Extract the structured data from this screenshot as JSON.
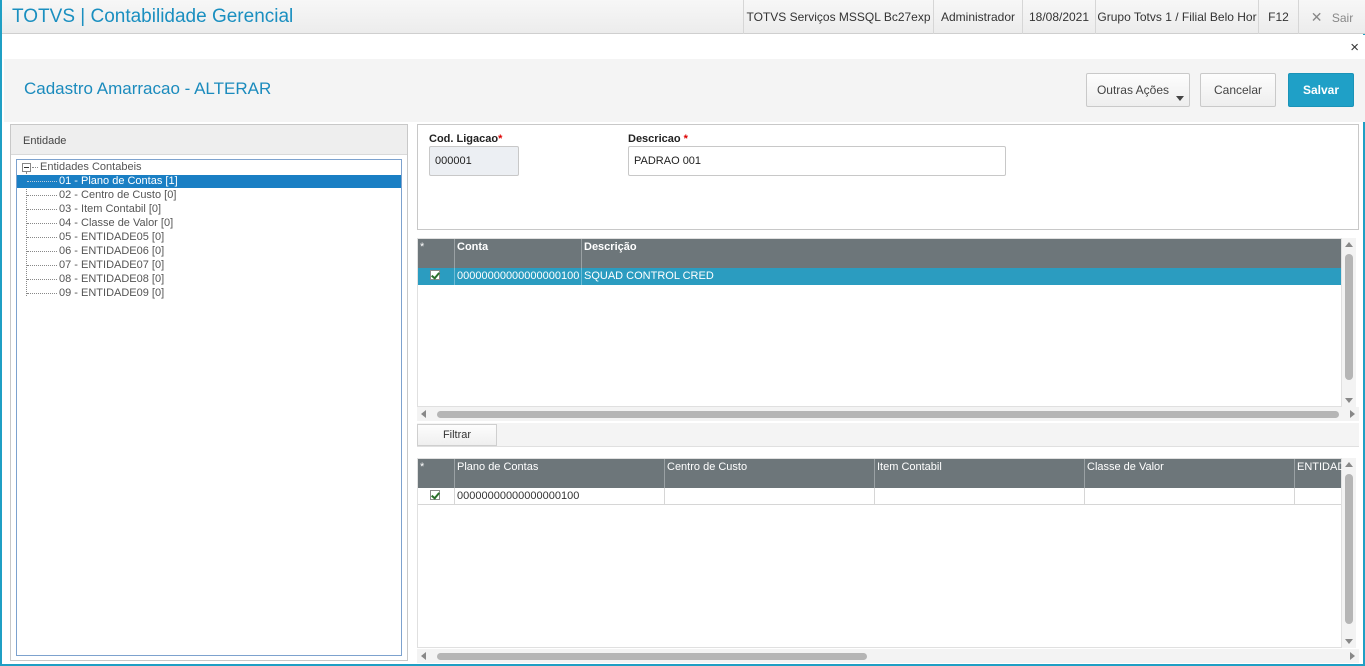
{
  "topbar": {
    "app_title": "TOTVS | Contabilidade Gerencial",
    "server": "TOTVS Serviços MSSQL Bc27exp",
    "user": "Administrador",
    "date": "18/08/2021",
    "branch": "Grupo Totvs 1 / Filial Belo Hor",
    "shortcut": "F12",
    "exit_label": "Sair"
  },
  "window": {
    "close_glyph": "×"
  },
  "header": {
    "title": "Cadastro Amarracao - ALTERAR",
    "other_actions_label": "Outras Ações",
    "cancel_label": "Cancelar",
    "save_label": "Salvar"
  },
  "left_panel": {
    "title": "Entidade",
    "tree_root": "Entidades Contabeis",
    "tree_items": [
      "01 - Plano de Contas [1]",
      "02 - Centro de Custo [0]",
      "03 - Item Contabil [0]",
      "04 - Classe de Valor [0]",
      "05 - ENTIDADE05 [0]",
      "06 - ENTIDADE06 [0]",
      "07 - ENTIDADE07 [0]",
      "08 - ENTIDADE08 [0]",
      "09 - ENTIDADE09 [0]"
    ]
  },
  "form": {
    "code_label": "Cod. Ligacao",
    "code_value": "000001",
    "desc_label": "Descricao",
    "desc_value": "PADRAO 001",
    "required_mark": "*"
  },
  "grid1": {
    "columns": [
      "*",
      "Conta",
      "Descrição"
    ],
    "rows": [
      {
        "conta": "00000000000000000100",
        "descricao": "SQUAD CONTROL CRED"
      }
    ]
  },
  "filter": {
    "label": "Filtrar"
  },
  "grid2": {
    "columns": [
      "*",
      "Plano de Contas",
      "Centro de Custo",
      "Item Contabil",
      "Classe de Valor",
      "ENTIDADE"
    ],
    "rows": [
      {
        "plano": "00000000000000000100",
        "centro": "",
        "item": "",
        "classe": "",
        "entidade": ""
      }
    ]
  },
  "colors": {
    "accent": "#1fa0c7",
    "title_blue": "#1b8bbd",
    "selection": "#1a7fc4",
    "grid_header": "#6d767a",
    "grid_selected": "#2b9cc0"
  }
}
